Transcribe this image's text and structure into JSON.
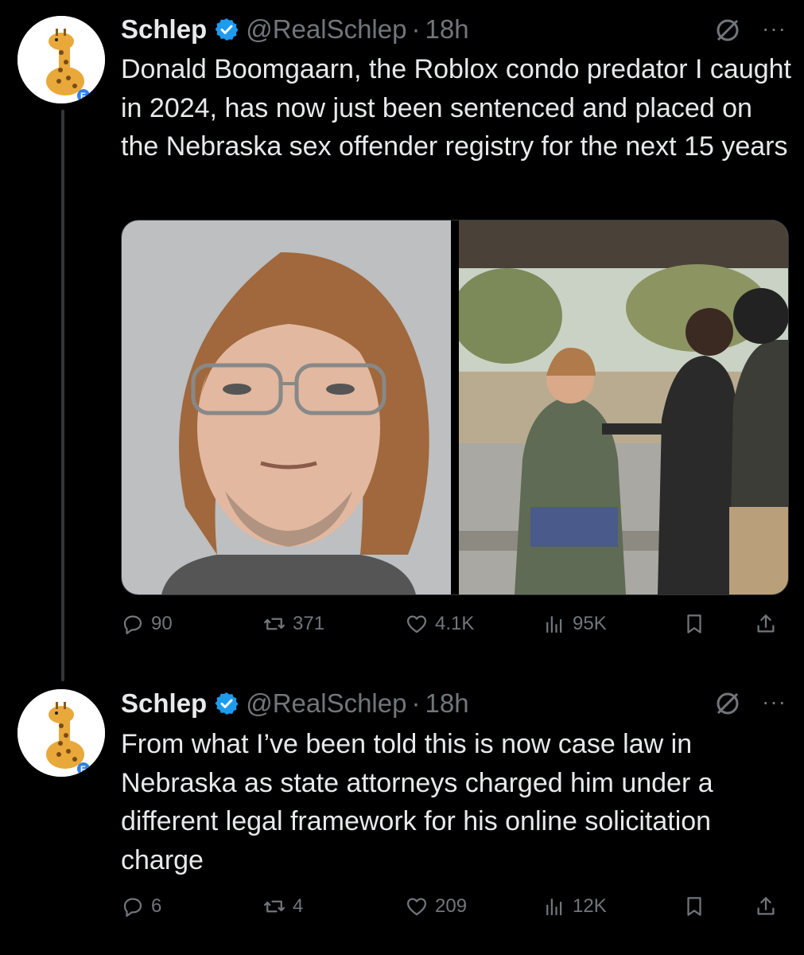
{
  "tweets": [
    {
      "author": {
        "name": "Schlep",
        "handle": "@RealSchlep",
        "time": "18h",
        "avatar": "giraffe-avatar"
      },
      "text": "Donald Boomgaarn, the Roblox condo predator I caught in 2024, has now just been sentenced and placed on the Nebraska sex offender registry for the next 15 years",
      "media": [
        "mugshot-photo",
        "arrest-scene-photo"
      ],
      "stats": {
        "replies": "90",
        "reposts": "371",
        "likes": "4.1K",
        "views": "95K"
      }
    },
    {
      "author": {
        "name": "Schlep",
        "handle": "@RealSchlep",
        "time": "18h",
        "avatar": "giraffe-avatar"
      },
      "text": "From what I’ve been told this is now case law in Nebraska as state attorneys charged him under a different legal framework for his online solicitation charge",
      "media": [],
      "stats": {
        "replies": "6",
        "reposts": "4",
        "likes": "209",
        "views": "12K"
      }
    }
  ],
  "ui": {
    "dot": "·",
    "more": "···"
  },
  "colors": {
    "background": "#000000",
    "text": "#e7e9ea",
    "muted": "#71767b",
    "verified": "#1d9bf0"
  }
}
